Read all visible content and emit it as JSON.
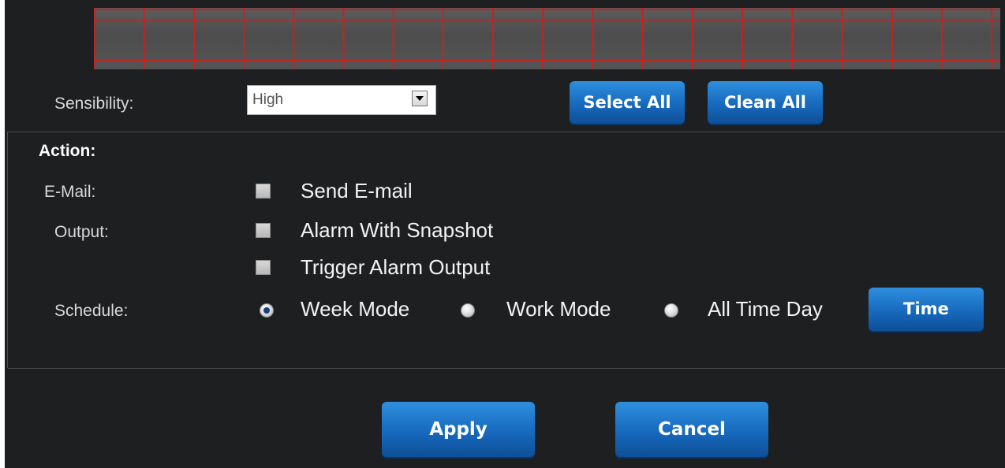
{
  "motion_grid": {
    "columns": 18,
    "rows": 2,
    "line_color": "#cc1f1f"
  },
  "sensibility": {
    "label": "Sensibility:",
    "selected": "High",
    "select_all_label": "Select All",
    "clean_all_label": "Clean All"
  },
  "action": {
    "heading": "Action:",
    "email_label": "E-Mail:",
    "send_email_label": "Send E-mail",
    "send_email_checked": false,
    "output_label": "Output:",
    "snapshot_label": "Alarm With Snapshot",
    "snapshot_checked": false,
    "trigger_label": "Trigger Alarm Output",
    "trigger_checked": false,
    "schedule_label": "Schedule:",
    "schedule_options": [
      "Week Mode",
      "Work Mode",
      "All Time Day"
    ],
    "schedule_selected": "Week Mode",
    "time_label": "Time"
  },
  "footer": {
    "apply_label": "Apply",
    "cancel_label": "Cancel"
  },
  "colors": {
    "panel_bg": "#1e1f21",
    "button_blue": "#1769bd",
    "grid_red": "#cc1f1f"
  }
}
